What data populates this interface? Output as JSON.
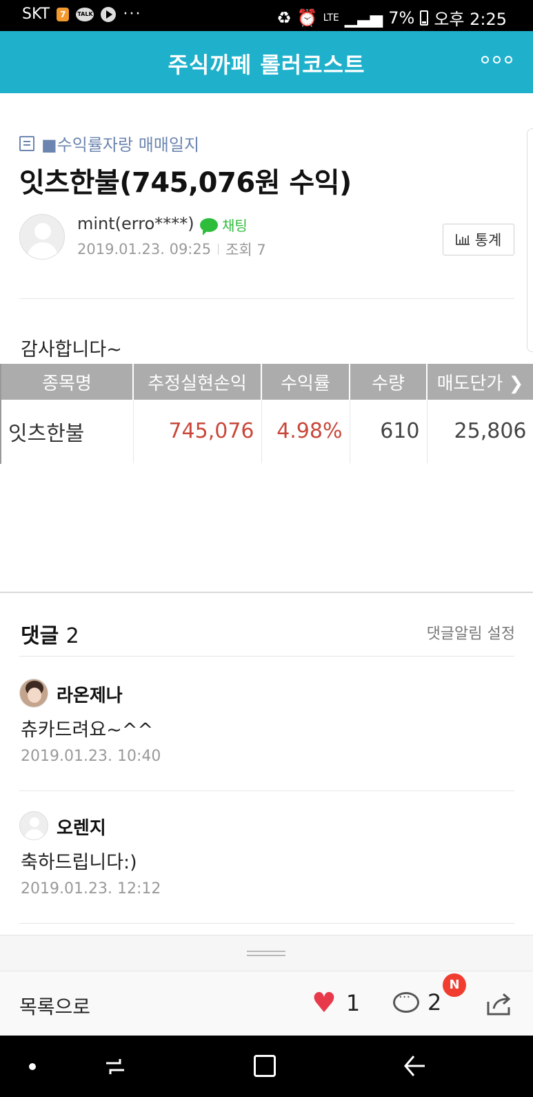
{
  "status_bar": {
    "carrier": "SKT",
    "badge": "7",
    "talk": "TALK",
    "dots": "···",
    "lte": "LTE",
    "battery": "7%",
    "time": "오후 2:25"
  },
  "header": {
    "title": "주식까페 롤러코스트"
  },
  "post": {
    "board": "■수익률자랑 매매일지",
    "title": "잇츠한불(745,076원 수익)",
    "author": "mint(erro****)",
    "chat_label": "채팅",
    "date": "2019.01.23. 09:25",
    "views": "조회 7",
    "stats_label": "통계",
    "body": "감사합니다~"
  },
  "trade_table": {
    "headers": [
      "종목명",
      "추정실현손익",
      "수익률",
      "수량",
      "매도단가 ❯"
    ],
    "row": {
      "name": "잇츠한불",
      "profit": "745,076",
      "rate": "4.98%",
      "qty": "610",
      "price": "25,806"
    }
  },
  "comments": {
    "title": "댓글",
    "count": "2",
    "alert_label": "댓글알림 설정",
    "items": [
      {
        "name": "라온제나",
        "text": "츄카드려요~^^",
        "date": "2019.01.23. 10:40"
      },
      {
        "name": "오렌지",
        "text": "축하드립니다:)",
        "date": "2019.01.23. 12:12"
      }
    ]
  },
  "bottom_bar": {
    "to_list": "목록으로",
    "like_count": "1",
    "comment_count": "2",
    "new_badge": "N"
  },
  "colors": {
    "header": "#1fb1cc",
    "board_label": "#6b85b0",
    "profit_red": "#c9473a",
    "chat_green": "#2dbd3b",
    "heart": "#e8394a",
    "badge": "#f13c30"
  },
  "icons": [
    "list-icon",
    "chat-icon",
    "bar-chart-icon",
    "heart-icon",
    "comment-icon",
    "share-icon",
    "more-icon"
  ]
}
